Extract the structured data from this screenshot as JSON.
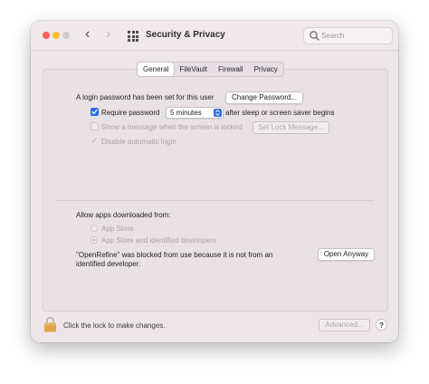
{
  "window": {
    "title": "Security & Privacy"
  },
  "search": {
    "placeholder": "Search"
  },
  "tabs": [
    {
      "label": "General",
      "active": true
    },
    {
      "label": "FileVault"
    },
    {
      "label": "Firewall"
    },
    {
      "label": "Privacy"
    }
  ],
  "general": {
    "password_notice": "A login password has been set for this user",
    "change_password_label": "Change Password...",
    "require_password_label": "Require password",
    "require_password_value": "5 minutes",
    "require_password_suffix": "after sleep or screen saver begins",
    "show_message_label": "Show a message when the screen is locked",
    "set_lock_message_label": "Set Lock Message...",
    "disable_auto_login_label": "Disable automatic login"
  },
  "downloads": {
    "heading": "Allow apps downloaded from:",
    "option_app_store": "App Store",
    "option_identified": "App Store and identified developers",
    "blocked_line1": "\"OpenRefine\" was blocked from use because it is not from an",
    "blocked_line2": "identified developer.",
    "open_anyway_label": "Open Anyway"
  },
  "footer": {
    "lock_text": "Click the lock to make changes.",
    "advanced_label": "Advanced...",
    "help_label": "?"
  },
  "colors": {
    "accent": "#2c6ee6",
    "lock": "#e2a34a"
  }
}
